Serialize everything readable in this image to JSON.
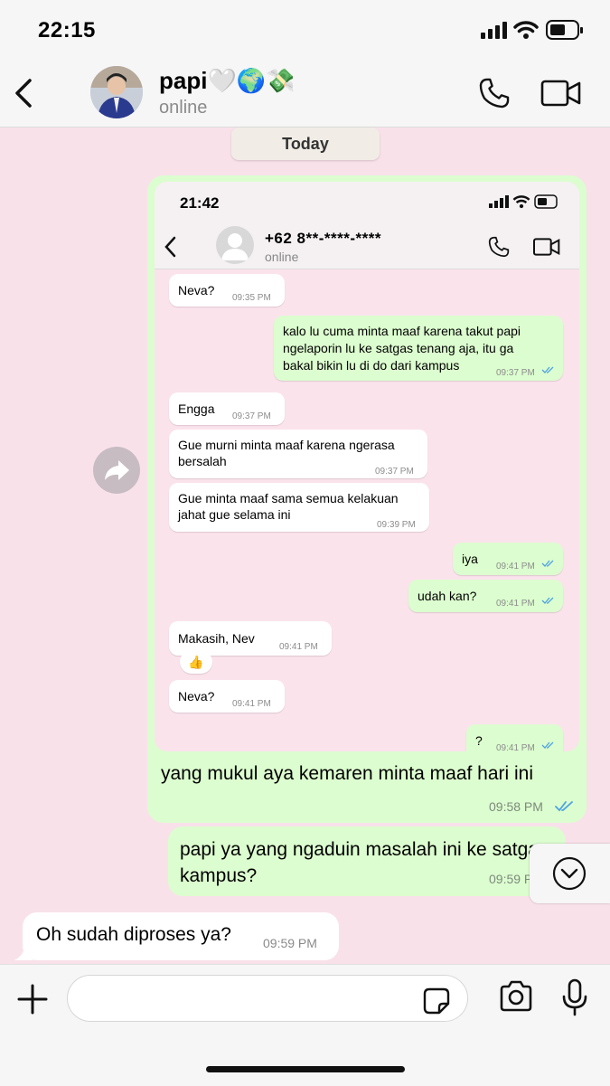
{
  "status_bar": {
    "time": "22:15"
  },
  "header": {
    "contact_name": "papi🤍🌍💸",
    "contact_status": "online"
  },
  "date_pill": "Today",
  "screenshot": {
    "time": "21:42",
    "contact_name": "+62 8**-****-****",
    "contact_status": "online",
    "messages": [
      {
        "dir": "in",
        "text": "Neva?",
        "time": "09:35 PM"
      },
      {
        "dir": "out",
        "lines": [
          "kalo lu cuma minta maaf karena takut papi",
          "ngelaporin lu ke satgas tenang aja, itu ga",
          "bakal bikin lu di do dari kampus"
        ],
        "time": "09:37 PM"
      },
      {
        "dir": "in",
        "text": "Engga",
        "time": "09:37 PM"
      },
      {
        "dir": "in",
        "lines": [
          "Gue murni minta maaf karena ngerasa",
          "bersalah"
        ],
        "time": "09:37 PM"
      },
      {
        "dir": "in",
        "lines": [
          "Gue minta maaf sama semua kelakuan",
          "jahat gue selama ini"
        ],
        "time": "09:39 PM"
      },
      {
        "dir": "out",
        "text": "iya",
        "time": "09:41 PM"
      },
      {
        "dir": "out",
        "text": "udah kan?",
        "time": "09:41 PM"
      },
      {
        "dir": "in",
        "text": "Makasih, Nev",
        "time": "09:41 PM",
        "reaction": "👍"
      },
      {
        "dir": "in",
        "text": "Neva?",
        "time": "09:41 PM"
      },
      {
        "dir": "out",
        "text": "?",
        "time": "09:41 PM"
      }
    ]
  },
  "messages": [
    {
      "dir": "out",
      "text": "yang mukul aya kemaren minta maaf hari ini",
      "time": "09:58 PM"
    },
    {
      "dir": "out",
      "lines": [
        "papi ya yang ngaduin masalah ini ke satgas",
        "kampus?"
      ],
      "time": "09:59 PM"
    },
    {
      "dir": "in",
      "text": "Oh sudah diproses ya?",
      "time": "09:59 PM"
    }
  ],
  "input": {
    "placeholder": ""
  },
  "colors": {
    "chat_bg": "#f9e1ea",
    "outgoing": "#dcfdcf",
    "incoming": "#ffffff",
    "tick_blue": "#4fa3e0"
  },
  "icons": [
    "back-icon",
    "phone-icon",
    "video-icon",
    "forward-icon",
    "chevron-down-icon",
    "plus-icon",
    "sticker-icon",
    "camera-icon",
    "mic-icon",
    "signal-icon",
    "wifi-icon",
    "battery-icon",
    "double-check-icon"
  ]
}
